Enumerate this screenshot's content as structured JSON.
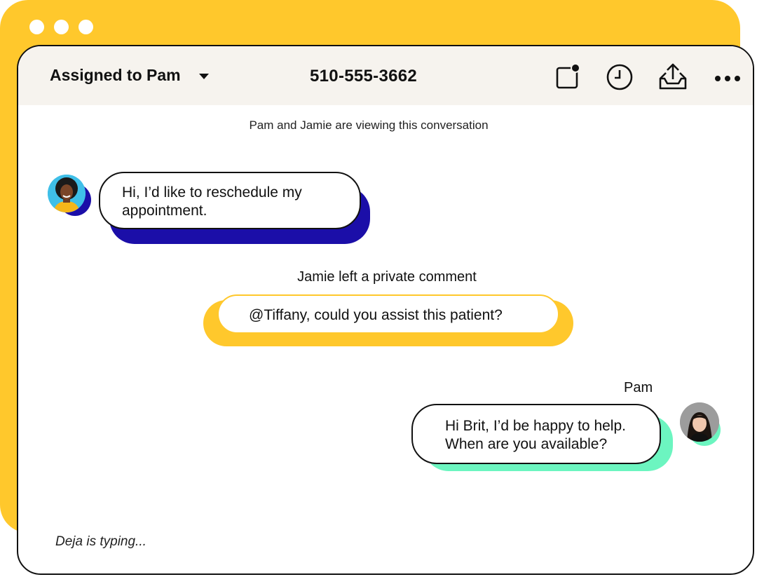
{
  "header": {
    "assigned_label": "Assigned to Pam",
    "phone": "510-555-3662",
    "icons": [
      "note-icon",
      "clock-icon",
      "inbox-upload-icon",
      "more-icon"
    ]
  },
  "conversation": {
    "viewing_notice": "Pam and Jamie are viewing this conversation",
    "messages": [
      {
        "from": "patient",
        "text_line1": "Hi, I’d like to reschedule my",
        "text_line2": "appointment."
      }
    ],
    "private_comment": {
      "label": "Jamie left a private comment",
      "text": "@Tiffany, could you assist this patient?"
    },
    "reply": {
      "sender": "Pam",
      "text_line1": "Hi Brit, I’d be happy to help.",
      "text_line2": "When are you available?"
    },
    "typing_indicator": "Deja is typing..."
  },
  "colors": {
    "back_window": "#ffc82c",
    "patient_shadow": "#1b0ea8",
    "comment_shadow": "#ffc82c",
    "reply_shadow": "#6cf5c0",
    "header_bg": "#f6f3ee"
  }
}
